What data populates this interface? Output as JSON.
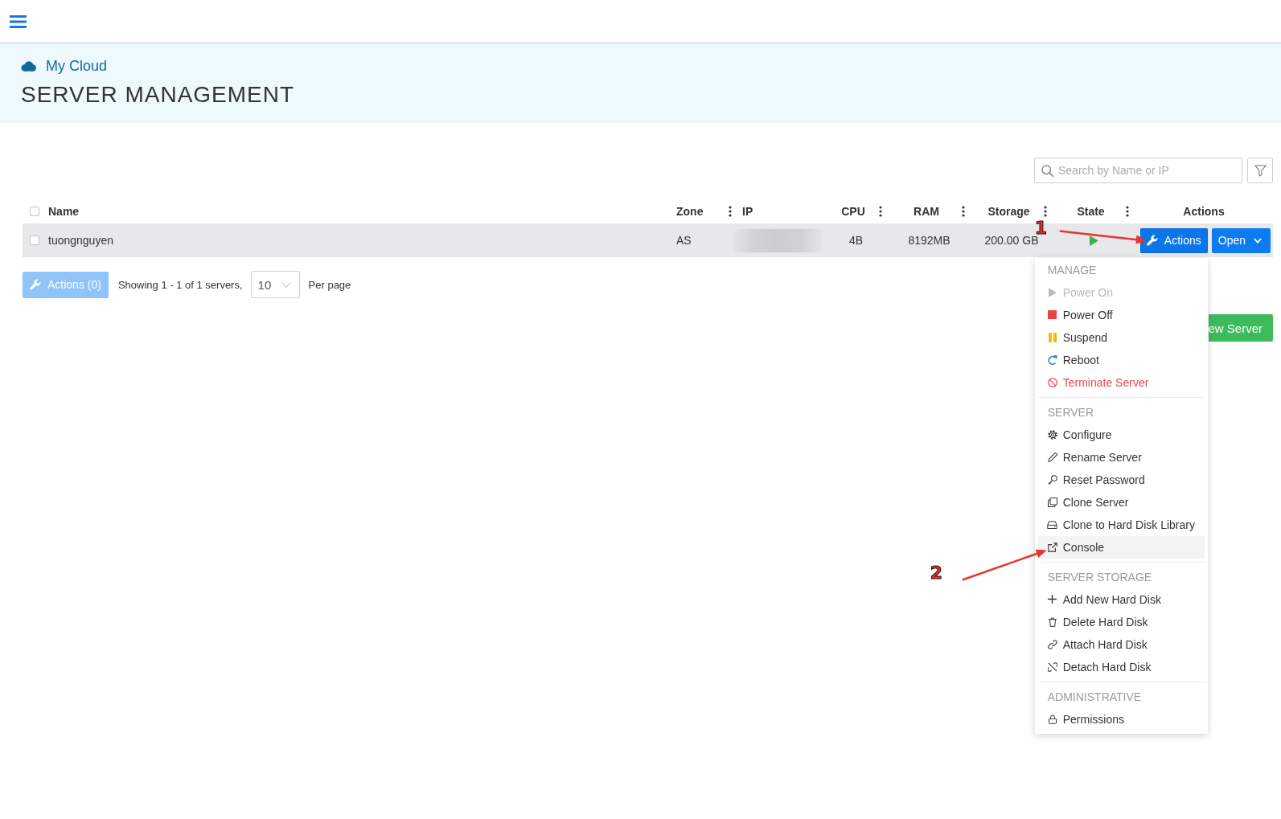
{
  "header": {
    "breadcrumb": "My Cloud",
    "title": "SERVER MANAGEMENT"
  },
  "search": {
    "placeholder": "Search by Name or IP"
  },
  "table": {
    "select_all": {
      "checked": false
    },
    "columns": [
      {
        "label": "Name",
        "has_menu": false
      },
      {
        "label": "Zone",
        "has_menu": true
      },
      {
        "label": "IP",
        "has_menu": false
      },
      {
        "label": "CPU",
        "has_menu": true
      },
      {
        "label": "RAM",
        "has_menu": true
      },
      {
        "label": "Storage",
        "has_menu": true
      },
      {
        "label": "State",
        "has_menu": true
      },
      {
        "label": "Actions",
        "has_menu": false
      }
    ],
    "rows": [
      {
        "checked": false,
        "hovered": true,
        "name": "tuongnguyen",
        "zone": "AS",
        "ip_hidden": true,
        "cpu": "4B",
        "ram": "8192MB",
        "storage": "200.00 GB",
        "running": true,
        "actions_button": {
          "label": "Actions",
          "expanded": true,
          "annotation": "1"
        },
        "open_button": {
          "label": "Open"
        }
      }
    ]
  },
  "footer": {
    "bulk_actions_button": {
      "label": "Actions (0)",
      "disabled": true
    },
    "summary": "Showing 1 - 1 of 1 servers,",
    "per_page": {
      "value": "10"
    },
    "per_page_label": "Per page"
  },
  "new_server_button": {
    "label": "ew Server"
  },
  "actions_menu": {
    "sections": [
      {
        "title": "MANAGE",
        "items": [
          {
            "label": "Power On",
            "kind": "normal",
            "disabled": true,
            "hovered": false
          },
          {
            "label": "Power Off",
            "kind": "normal",
            "disabled": false,
            "hovered": false
          },
          {
            "label": "Suspend",
            "kind": "normal",
            "disabled": false,
            "hovered": false
          },
          {
            "label": "Reboot",
            "kind": "normal",
            "disabled": false,
            "hovered": false
          },
          {
            "label": "Terminate Server",
            "kind": "danger",
            "disabled": false,
            "hovered": false
          }
        ]
      },
      {
        "title": "SERVER",
        "items": [
          {
            "label": "Configure",
            "kind": "normal",
            "disabled": false,
            "hovered": false
          },
          {
            "label": "Rename Server",
            "kind": "normal",
            "disabled": false,
            "hovered": false
          },
          {
            "label": "Reset Password",
            "kind": "normal",
            "disabled": false,
            "hovered": false
          },
          {
            "label": "Clone Server",
            "kind": "normal",
            "disabled": false,
            "hovered": false
          },
          {
            "label": "Clone to Hard Disk Library",
            "kind": "normal",
            "disabled": false,
            "hovered": false
          },
          {
            "label": "Console",
            "kind": "normal",
            "disabled": false,
            "hovered": true,
            "annotation": "2"
          }
        ]
      },
      {
        "title": "SERVER STORAGE",
        "items": [
          {
            "label": "Add New Hard Disk",
            "kind": "normal",
            "disabled": false,
            "hovered": false
          },
          {
            "label": "Delete Hard Disk",
            "kind": "normal",
            "disabled": false,
            "hovered": false
          },
          {
            "label": "Attach Hard Disk",
            "kind": "normal",
            "disabled": false,
            "hovered": false
          },
          {
            "label": "Detach Hard Disk",
            "kind": "normal",
            "disabled": false,
            "hovered": false
          }
        ]
      },
      {
        "title": "ADMINISTRATIVE",
        "items": [
          {
            "label": "Permissions",
            "kind": "normal",
            "disabled": false,
            "hovered": false
          }
        ]
      }
    ]
  }
}
